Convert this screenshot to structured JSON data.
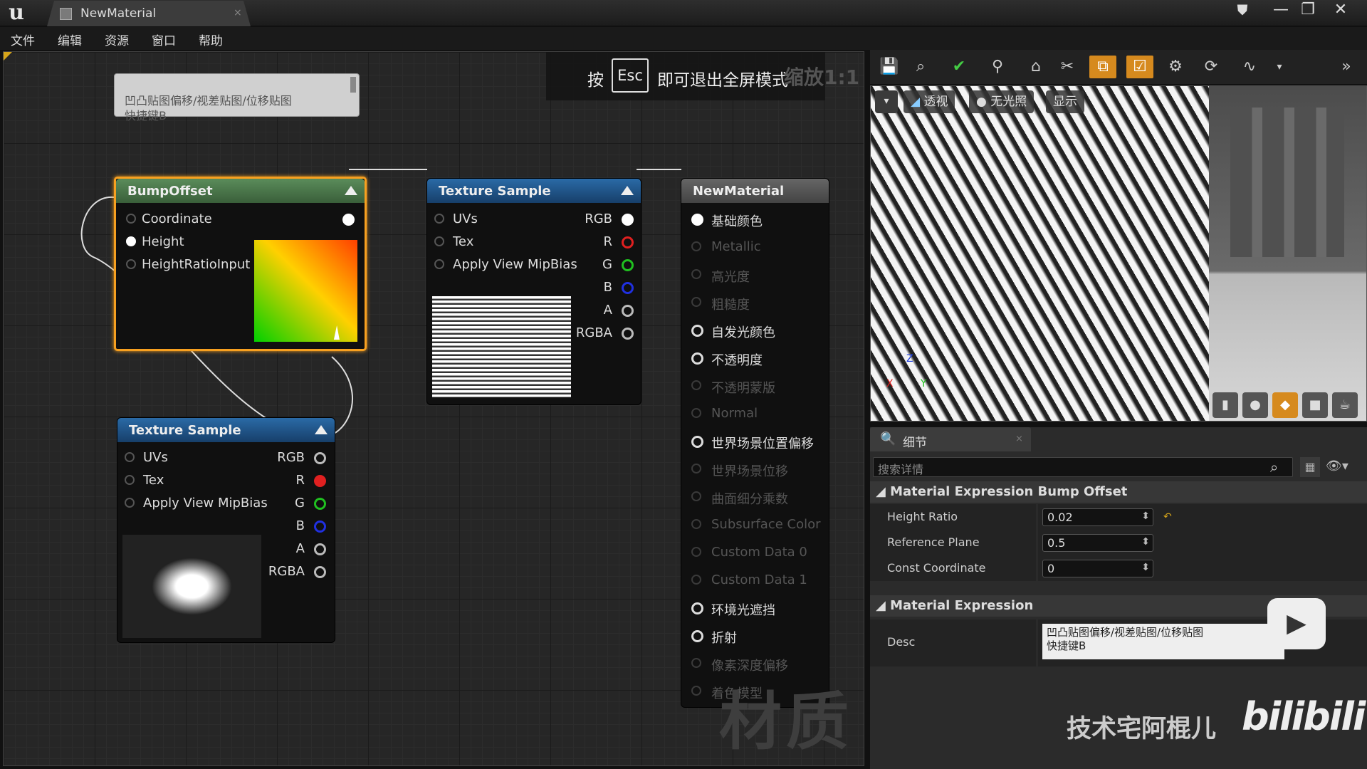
{
  "titlebar": {
    "app_logo": "u",
    "tab_label": "NewMaterial",
    "tab_close": "×",
    "window_buttons": [
      "—",
      "❐",
      "✕"
    ]
  },
  "menu": [
    "文件",
    "编辑",
    "资源",
    "窗口",
    "帮助"
  ],
  "graph": {
    "esc_banner": {
      "pre": "按",
      "key": "Esc",
      "post": "即可退出全屏模式"
    },
    "zoom": "缩放1:1",
    "comment": "凹凸贴图偏移/视差贴图/位移贴图\n快捷键B",
    "watermark": "材质",
    "bump_node": {
      "title": "BumpOffset",
      "inputs": [
        "Coordinate",
        "Height",
        "HeightRatioInput"
      ]
    },
    "texture_sample_1": {
      "title": "Texture Sample",
      "inputs": [
        "UVs",
        "Tex",
        "Apply View MipBias"
      ],
      "outputs": [
        "RGB",
        "R",
        "G",
        "B",
        "A",
        "RGBA"
      ]
    },
    "texture_sample_2": {
      "title": "Texture Sample",
      "inputs": [
        "UVs",
        "Tex",
        "Apply View MipBias"
      ],
      "outputs": [
        "RGB",
        "R",
        "G",
        "B",
        "A",
        "RGBA"
      ]
    },
    "material_node": {
      "title": "NewMaterial",
      "inputs": [
        {
          "label": "基础颜色",
          "active": true
        },
        {
          "label": "Metallic",
          "active": false
        },
        {
          "label": "高光度",
          "active": false
        },
        {
          "label": "粗糙度",
          "active": false
        },
        {
          "label": "自发光颜色",
          "active": true
        },
        {
          "label": "不透明度",
          "active": true
        },
        {
          "label": "不透明蒙版",
          "active": false
        },
        {
          "label": "Normal",
          "active": false
        },
        {
          "label": "世界场景位置偏移",
          "active": true
        },
        {
          "label": "世界场景位移",
          "active": false
        },
        {
          "label": "曲面细分乘数",
          "active": false
        },
        {
          "label": "Subsurface Color",
          "active": false
        },
        {
          "label": "Custom Data 0",
          "active": false
        },
        {
          "label": "Custom Data 1",
          "active": false
        },
        {
          "label": "环境光遮挡",
          "active": true
        },
        {
          "label": "折射",
          "active": true
        },
        {
          "label": "像素深度偏移",
          "active": false
        },
        {
          "label": "着色模型",
          "active": false
        }
      ]
    }
  },
  "viewport": {
    "view_menu": "▾",
    "perspective": "透视",
    "lit": "无光照",
    "show": "显示",
    "axes": {
      "x": "X",
      "y": "Y",
      "z": "Z"
    }
  },
  "details": {
    "tab_label": "细节",
    "tab_close": "×",
    "search_placeholder": "搜索详情",
    "category_bump": "Material Expression Bump Offset",
    "props": [
      {
        "label": "Height Ratio",
        "value": "0.02"
      },
      {
        "label": "Reference Plane",
        "value": "0.5"
      },
      {
        "label": "Const Coordinate",
        "value": "0"
      }
    ],
    "category_expr": "Material Expression",
    "desc_label": "Desc",
    "desc_value": "凹凸贴图偏移/视差贴图/位移贴图\n快捷键B"
  },
  "branding": {
    "text": "技术宅阿棍儿",
    "logo": "bilibili"
  },
  "colors": {
    "accent": "#d68a1e",
    "selection": "#f7a020",
    "texture_head": "#2a6aa6",
    "bump_head": "#5a8c5a",
    "pin_red": "#e02020",
    "pin_green": "#20c020",
    "pin_blue": "#2030e0"
  }
}
